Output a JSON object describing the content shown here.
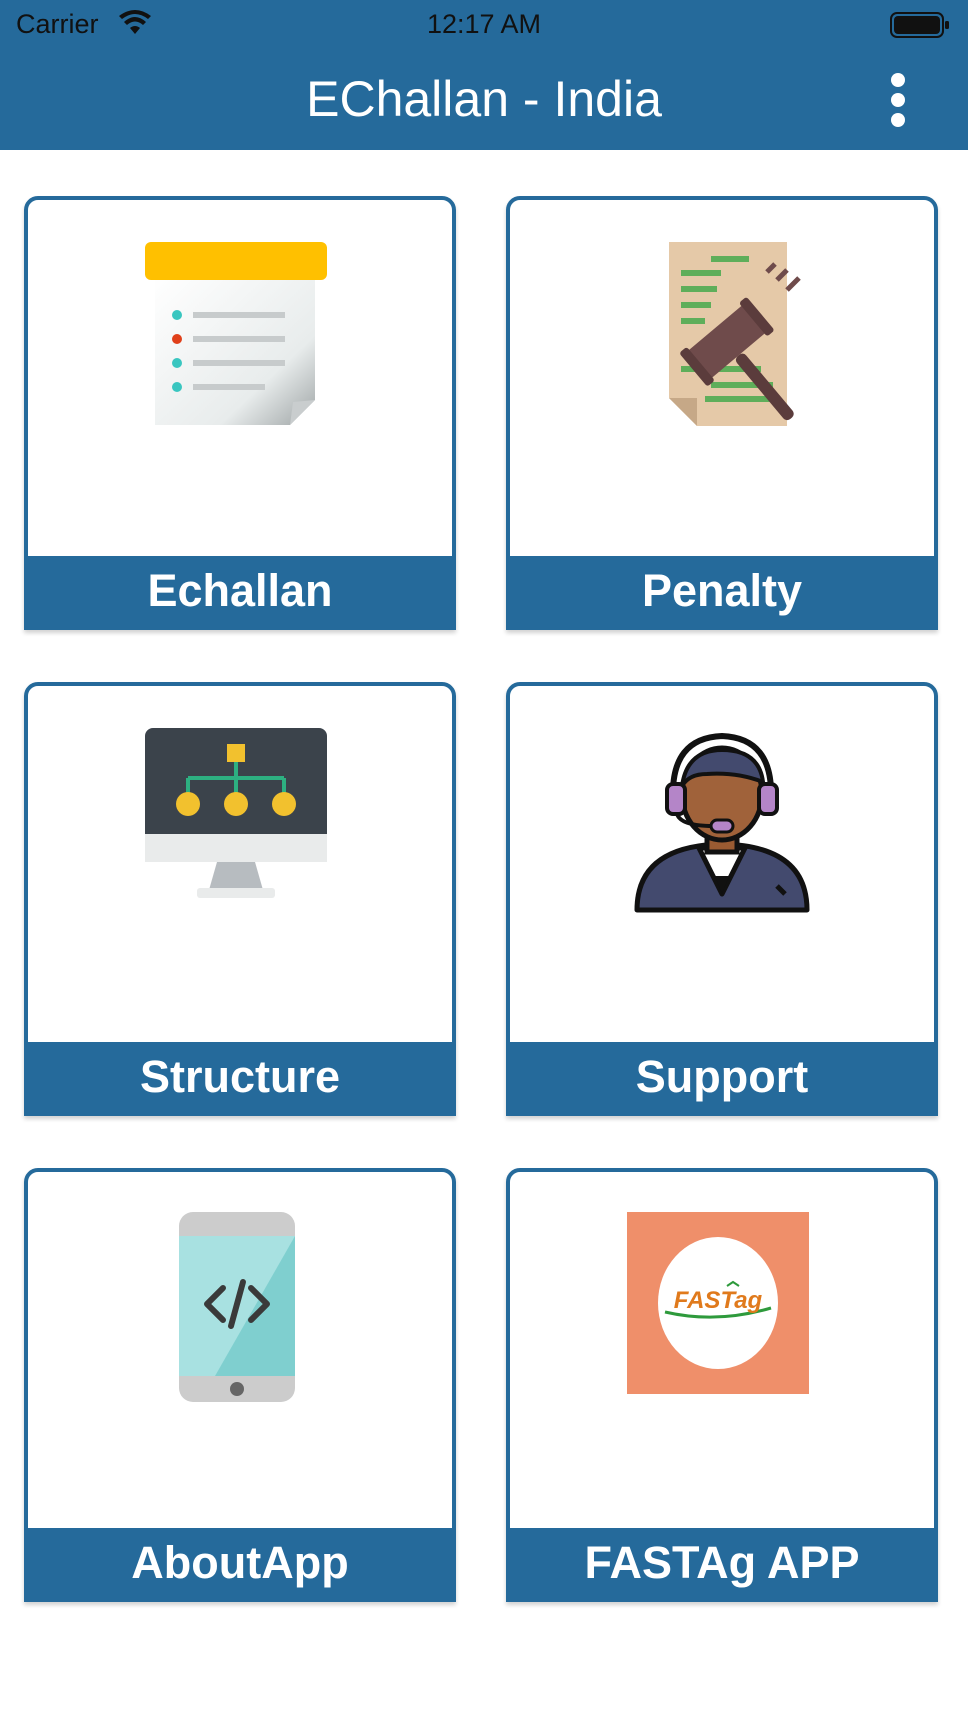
{
  "status_bar": {
    "carrier": "Carrier",
    "time": "12:17 AM"
  },
  "nav": {
    "title": "EChallan - India",
    "menu_icon": "more-vertical-icon"
  },
  "tiles": [
    {
      "label": "Echallan",
      "icon": "checklist-document-icon"
    },
    {
      "label": "Penalty",
      "icon": "gavel-document-icon"
    },
    {
      "label": "Structure",
      "icon": "monitor-hierarchy-icon"
    },
    {
      "label": "Support",
      "icon": "support-agent-headset-icon"
    },
    {
      "label": "AboutApp",
      "icon": "phone-code-icon"
    },
    {
      "label": "FASTAg APP",
      "icon": "fastag-logo-icon"
    }
  ],
  "colors": {
    "primary": "#256a9b",
    "label_text": "#ffffff"
  }
}
